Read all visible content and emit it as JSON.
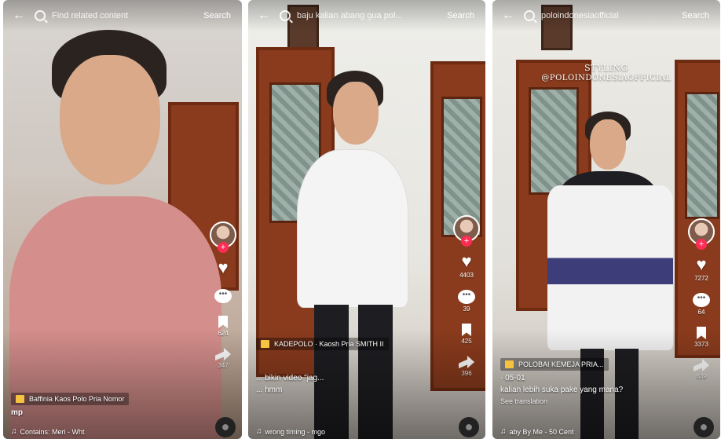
{
  "panels": [
    {
      "search_text": "Find related content",
      "search_button": "Search",
      "overlay_title": "",
      "overlay_subtitle": "",
      "counts": {
        "likes": "",
        "comments": "",
        "saves": "624",
        "shares": "347"
      },
      "product_chip": "Baffinia Kaos Polo Pria Nomor",
      "caption_user": "mp",
      "caption_lines": [],
      "music": "Contains: Meri - Wht"
    },
    {
      "search_text": "baju kalian abang gua pol...",
      "search_button": "Search",
      "overlay_title": "",
      "overlay_subtitle": "",
      "counts": {
        "likes": "4403",
        "comments": "39",
        "saves": "425",
        "shares": "396"
      },
      "product_chip": "KADEPOLO · Kaosh Pria SMITH II",
      "caption_user": "",
      "caption_lines": [
        "... bikin video \"jag...",
        "... hmm"
      ],
      "music": "wrong timing - mgo"
    },
    {
      "search_text": "poloindonesiaofficial",
      "search_button": "Search",
      "overlay_title": "STYLING",
      "overlay_subtitle": "@POLOINDONESIAOFFICIAL",
      "counts": {
        "likes": "7272",
        "comments": "64",
        "saves": "3373",
        "shares": "639"
      },
      "product_chip": "POLOBAI KEMEJA PRIA...",
      "caption_user": "· 05-01",
      "caption_lines": [
        "kalian lebih suka pake yang mana?",
        "See translation"
      ],
      "music": "aby By Me - 50 Cent"
    }
  ],
  "icons": {
    "back": "arrow-left-icon",
    "search": "search-icon",
    "like": "heart-icon",
    "comment": "comment-icon",
    "save": "bookmark-icon",
    "share": "share-icon",
    "music": "music-note-icon",
    "product": "shopping-bag-icon"
  },
  "colors": {
    "follow_badge": "#fe2c55",
    "product_icon": "#f6c341"
  }
}
